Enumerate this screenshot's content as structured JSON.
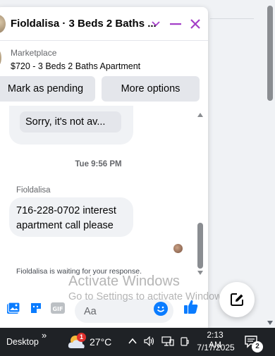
{
  "chat": {
    "title": "Fioldalisa · 3 Beds 2 Baths ...",
    "listing": {
      "label": "Marketplace",
      "title": "$720 - 3 Beds 2 Baths Apartment"
    },
    "actions": {
      "mark_pending": "Mark as pending",
      "more_options": "More options"
    },
    "messages": {
      "top_reply": "Sorry, it's not av...",
      "timestamp": "Tue 9:56 PM",
      "sender": "Fioldalisa",
      "message": "716-228-0702 interest apartment call please",
      "waiting": "Fioldalisa is waiting for your response."
    },
    "composer": {
      "placeholder": "Aa"
    },
    "accent_color": "#a33ec7",
    "messenger_blue": "#0a7cff"
  },
  "watermark": {
    "line1": "Activate Windows",
    "line2": "Go to Settings to activate Windows."
  },
  "taskbar": {
    "desktop_label": "Desktop",
    "chevron": "»",
    "weather_badge": "1",
    "temperature": "27°C",
    "time": "2:13 AM",
    "date": "7/17/2025",
    "notification_count": "2"
  }
}
